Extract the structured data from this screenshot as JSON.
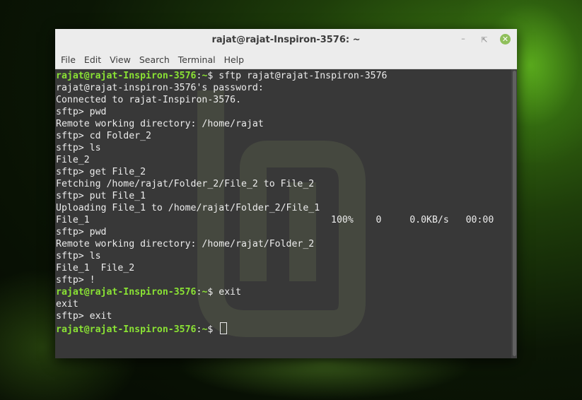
{
  "window": {
    "title": "rajat@rajat-Inspiron-3576: ~",
    "controls": [
      "minimize-icon",
      "maximize-icon",
      "close-icon"
    ]
  },
  "menubar": {
    "items": [
      "File",
      "Edit",
      "View",
      "Search",
      "Terminal",
      "Help"
    ]
  },
  "prompt": {
    "user": "rajat@rajat-Inspiron-3576",
    "colon": ":",
    "dir": "~",
    "sign": "$"
  },
  "terminal": {
    "lines": [
      {
        "type": "prompt",
        "cmd": " sftp rajat@rajat-Inspiron-3576"
      },
      {
        "type": "text",
        "text": "rajat@rajat-inspiron-3576's password:"
      },
      {
        "type": "text",
        "text": "Connected to rajat-Inspiron-3576."
      },
      {
        "type": "text",
        "text": "sftp> pwd"
      },
      {
        "type": "text",
        "text": "Remote working directory: /home/rajat"
      },
      {
        "type": "text",
        "text": "sftp> cd Folder_2"
      },
      {
        "type": "text",
        "text": "sftp> ls"
      },
      {
        "type": "text",
        "text": "File_2"
      },
      {
        "type": "text",
        "text": "sftp> get File_2"
      },
      {
        "type": "text",
        "text": "Fetching /home/rajat/Folder_2/File_2 to File_2"
      },
      {
        "type": "text",
        "text": "sftp> put File_1"
      },
      {
        "type": "text",
        "text": "Uploading File_1 to /home/rajat/Folder_2/File_1"
      },
      {
        "type": "text",
        "text": "File_1                                           100%    0     0.0KB/s   00:00"
      },
      {
        "type": "text",
        "text": "sftp> pwd"
      },
      {
        "type": "text",
        "text": "Remote working directory: /home/rajat/Folder_2"
      },
      {
        "type": "text",
        "text": "sftp> ls"
      },
      {
        "type": "text",
        "text": "File_1  File_2"
      },
      {
        "type": "text",
        "text": "sftp> !"
      },
      {
        "type": "prompt",
        "cmd": " exit"
      },
      {
        "type": "text",
        "text": "exit"
      },
      {
        "type": "text",
        "text": "sftp> exit"
      },
      {
        "type": "prompt",
        "cmd": " ",
        "cursor": true
      }
    ]
  },
  "colors": {
    "prompt_user": "#8ae234",
    "terminal_bg": "#383838",
    "terminal_fg": "#ececec",
    "close_button": "#8fbf5a"
  }
}
